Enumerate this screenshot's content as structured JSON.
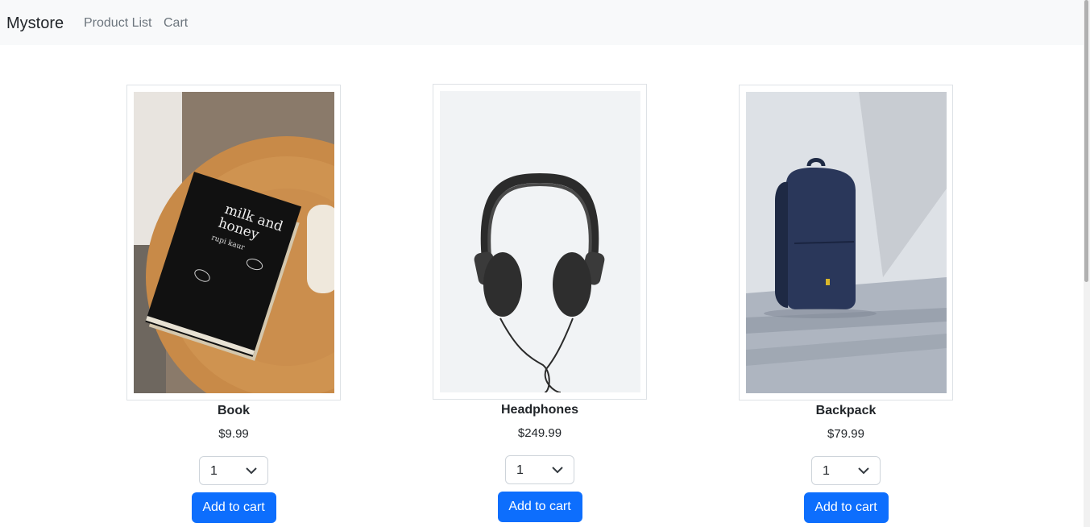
{
  "navbar": {
    "brand": "Mystore",
    "links": [
      "Product List",
      "Cart"
    ]
  },
  "products": [
    {
      "name": "Book",
      "price": "$9.99",
      "quantity": "1",
      "button": "Add to cart",
      "image_text": {
        "title_line1": "milk and",
        "title_line2": "honey",
        "author": "rupi kaur"
      }
    },
    {
      "name": "Headphones",
      "price": "$249.99",
      "quantity": "1",
      "button": "Add to cart"
    },
    {
      "name": "Backpack",
      "price": "$79.99",
      "quantity": "1",
      "button": "Add to cart"
    }
  ],
  "colors": {
    "navbar_bg": "#f8f9fa",
    "primary_button": "#0d6efd",
    "muted_link": "#6c757d"
  }
}
